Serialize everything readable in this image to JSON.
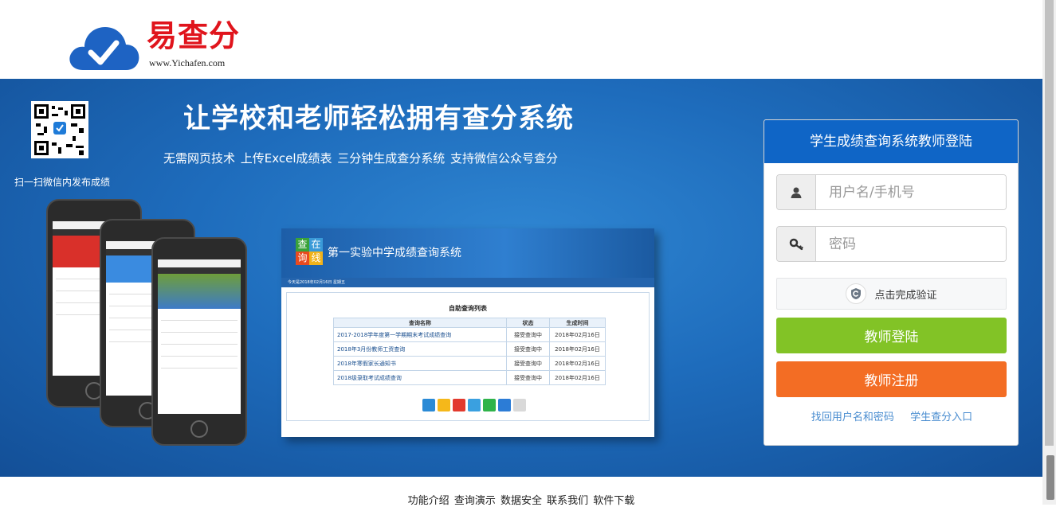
{
  "logo": {
    "title": "易查分",
    "url": "www.Yichafen.com"
  },
  "banner": {
    "headline": "让学校和老师轻松拥有查分系统",
    "subline": "无需网页技术 上传Excel成绩表 三分钟生成查分系统   支持微信公众号查分",
    "qr_caption": "扫一扫微信内发布成绩"
  },
  "demo": {
    "logo_chars": [
      "查",
      "在",
      "询",
      "线"
    ],
    "title": "第一实验中学成绩查询系统",
    "date": "今天是2018年02月16日 星期五",
    "list_title": "自助查询列表",
    "headers": [
      "查询名称",
      "状态",
      "生成时间"
    ],
    "rows": [
      [
        "2017-2018学年度第一学期期末考试成绩查询",
        "接受查询中",
        "2018年02月16日"
      ],
      [
        "2018年3月份教师工资查询",
        "接受查询中",
        "2018年02月16日"
      ],
      [
        "2018年寒假家长通知书",
        "接受查询中",
        "2018年02月16日"
      ],
      [
        "2018级录取考试成绩查询",
        "接受查询中",
        "2018年02月16日"
      ]
    ]
  },
  "login": {
    "title": "学生成绩查询系统教师登陆",
    "username_placeholder": "用户名/手机号",
    "password_placeholder": "密码",
    "verify_label": "点击完成验证",
    "login_button": "教师登陆",
    "register_button": "教师注册",
    "forgot_link": "找回用户名和密码",
    "student_link": "学生查分入口"
  },
  "footer": {
    "links": [
      "功能介绍",
      "查询演示",
      "数据安全",
      "联系我们",
      "软件下载"
    ]
  },
  "colors": {
    "brand_red": "#e0141c",
    "banner_blue": "#1e6cbc",
    "login_header": "#0f65c6",
    "login_green": "#82c326",
    "register_orange": "#f36d24",
    "link_blue": "#4a8dd0"
  },
  "icons": [
    "cloud-check-logo-icon",
    "qr-code-icon",
    "user-icon",
    "key-icon",
    "shield-verify-icon"
  ]
}
